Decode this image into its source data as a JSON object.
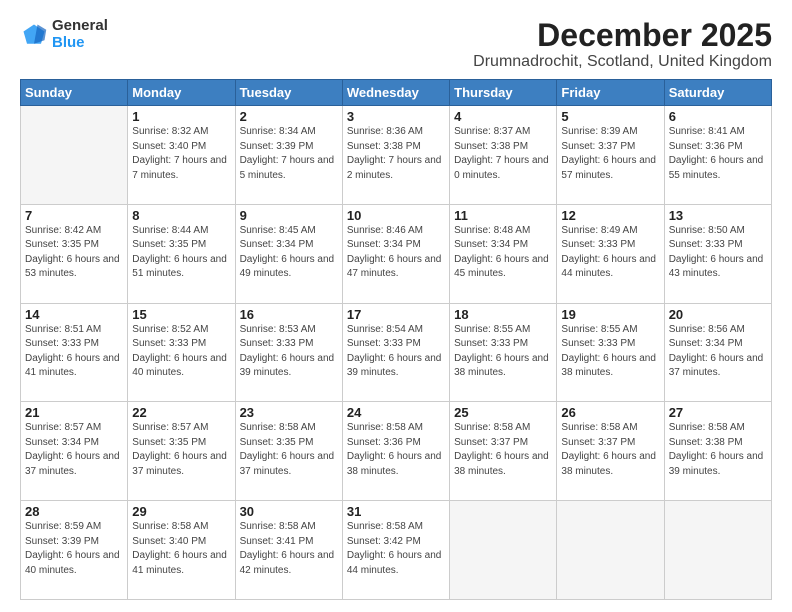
{
  "logo": {
    "general": "General",
    "blue": "Blue"
  },
  "title": "December 2025",
  "subtitle": "Drumnadrochit, Scotland, United Kingdom",
  "days_header": [
    "Sunday",
    "Monday",
    "Tuesday",
    "Wednesday",
    "Thursday",
    "Friday",
    "Saturday"
  ],
  "weeks": [
    [
      {
        "day": "",
        "sunrise": "",
        "sunset": "",
        "daylight": ""
      },
      {
        "day": "1",
        "sunrise": "Sunrise: 8:32 AM",
        "sunset": "Sunset: 3:40 PM",
        "daylight": "Daylight: 7 hours and 7 minutes."
      },
      {
        "day": "2",
        "sunrise": "Sunrise: 8:34 AM",
        "sunset": "Sunset: 3:39 PM",
        "daylight": "Daylight: 7 hours and 5 minutes."
      },
      {
        "day": "3",
        "sunrise": "Sunrise: 8:36 AM",
        "sunset": "Sunset: 3:38 PM",
        "daylight": "Daylight: 7 hours and 2 minutes."
      },
      {
        "day": "4",
        "sunrise": "Sunrise: 8:37 AM",
        "sunset": "Sunset: 3:38 PM",
        "daylight": "Daylight: 7 hours and 0 minutes."
      },
      {
        "day": "5",
        "sunrise": "Sunrise: 8:39 AM",
        "sunset": "Sunset: 3:37 PM",
        "daylight": "Daylight: 6 hours and 57 minutes."
      },
      {
        "day": "6",
        "sunrise": "Sunrise: 8:41 AM",
        "sunset": "Sunset: 3:36 PM",
        "daylight": "Daylight: 6 hours and 55 minutes."
      }
    ],
    [
      {
        "day": "7",
        "sunrise": "Sunrise: 8:42 AM",
        "sunset": "Sunset: 3:35 PM",
        "daylight": "Daylight: 6 hours and 53 minutes."
      },
      {
        "day": "8",
        "sunrise": "Sunrise: 8:44 AM",
        "sunset": "Sunset: 3:35 PM",
        "daylight": "Daylight: 6 hours and 51 minutes."
      },
      {
        "day": "9",
        "sunrise": "Sunrise: 8:45 AM",
        "sunset": "Sunset: 3:34 PM",
        "daylight": "Daylight: 6 hours and 49 minutes."
      },
      {
        "day": "10",
        "sunrise": "Sunrise: 8:46 AM",
        "sunset": "Sunset: 3:34 PM",
        "daylight": "Daylight: 6 hours and 47 minutes."
      },
      {
        "day": "11",
        "sunrise": "Sunrise: 8:48 AM",
        "sunset": "Sunset: 3:34 PM",
        "daylight": "Daylight: 6 hours and 45 minutes."
      },
      {
        "day": "12",
        "sunrise": "Sunrise: 8:49 AM",
        "sunset": "Sunset: 3:33 PM",
        "daylight": "Daylight: 6 hours and 44 minutes."
      },
      {
        "day": "13",
        "sunrise": "Sunrise: 8:50 AM",
        "sunset": "Sunset: 3:33 PM",
        "daylight": "Daylight: 6 hours and 43 minutes."
      }
    ],
    [
      {
        "day": "14",
        "sunrise": "Sunrise: 8:51 AM",
        "sunset": "Sunset: 3:33 PM",
        "daylight": "Daylight: 6 hours and 41 minutes."
      },
      {
        "day": "15",
        "sunrise": "Sunrise: 8:52 AM",
        "sunset": "Sunset: 3:33 PM",
        "daylight": "Daylight: 6 hours and 40 minutes."
      },
      {
        "day": "16",
        "sunrise": "Sunrise: 8:53 AM",
        "sunset": "Sunset: 3:33 PM",
        "daylight": "Daylight: 6 hours and 39 minutes."
      },
      {
        "day": "17",
        "sunrise": "Sunrise: 8:54 AM",
        "sunset": "Sunset: 3:33 PM",
        "daylight": "Daylight: 6 hours and 39 minutes."
      },
      {
        "day": "18",
        "sunrise": "Sunrise: 8:55 AM",
        "sunset": "Sunset: 3:33 PM",
        "daylight": "Daylight: 6 hours and 38 minutes."
      },
      {
        "day": "19",
        "sunrise": "Sunrise: 8:55 AM",
        "sunset": "Sunset: 3:33 PM",
        "daylight": "Daylight: 6 hours and 38 minutes."
      },
      {
        "day": "20",
        "sunrise": "Sunrise: 8:56 AM",
        "sunset": "Sunset: 3:34 PM",
        "daylight": "Daylight: 6 hours and 37 minutes."
      }
    ],
    [
      {
        "day": "21",
        "sunrise": "Sunrise: 8:57 AM",
        "sunset": "Sunset: 3:34 PM",
        "daylight": "Daylight: 6 hours and 37 minutes."
      },
      {
        "day": "22",
        "sunrise": "Sunrise: 8:57 AM",
        "sunset": "Sunset: 3:35 PM",
        "daylight": "Daylight: 6 hours and 37 minutes."
      },
      {
        "day": "23",
        "sunrise": "Sunrise: 8:58 AM",
        "sunset": "Sunset: 3:35 PM",
        "daylight": "Daylight: 6 hours and 37 minutes."
      },
      {
        "day": "24",
        "sunrise": "Sunrise: 8:58 AM",
        "sunset": "Sunset: 3:36 PM",
        "daylight": "Daylight: 6 hours and 38 minutes."
      },
      {
        "day": "25",
        "sunrise": "Sunrise: 8:58 AM",
        "sunset": "Sunset: 3:37 PM",
        "daylight": "Daylight: 6 hours and 38 minutes."
      },
      {
        "day": "26",
        "sunrise": "Sunrise: 8:58 AM",
        "sunset": "Sunset: 3:37 PM",
        "daylight": "Daylight: 6 hours and 38 minutes."
      },
      {
        "day": "27",
        "sunrise": "Sunrise: 8:58 AM",
        "sunset": "Sunset: 3:38 PM",
        "daylight": "Daylight: 6 hours and 39 minutes."
      }
    ],
    [
      {
        "day": "28",
        "sunrise": "Sunrise: 8:59 AM",
        "sunset": "Sunset: 3:39 PM",
        "daylight": "Daylight: 6 hours and 40 minutes."
      },
      {
        "day": "29",
        "sunrise": "Sunrise: 8:58 AM",
        "sunset": "Sunset: 3:40 PM",
        "daylight": "Daylight: 6 hours and 41 minutes."
      },
      {
        "day": "30",
        "sunrise": "Sunrise: 8:58 AM",
        "sunset": "Sunset: 3:41 PM",
        "daylight": "Daylight: 6 hours and 42 minutes."
      },
      {
        "day": "31",
        "sunrise": "Sunrise: 8:58 AM",
        "sunset": "Sunset: 3:42 PM",
        "daylight": "Daylight: 6 hours and 44 minutes."
      },
      {
        "day": "",
        "sunrise": "",
        "sunset": "",
        "daylight": ""
      },
      {
        "day": "",
        "sunrise": "",
        "sunset": "",
        "daylight": ""
      },
      {
        "day": "",
        "sunrise": "",
        "sunset": "",
        "daylight": ""
      }
    ]
  ]
}
